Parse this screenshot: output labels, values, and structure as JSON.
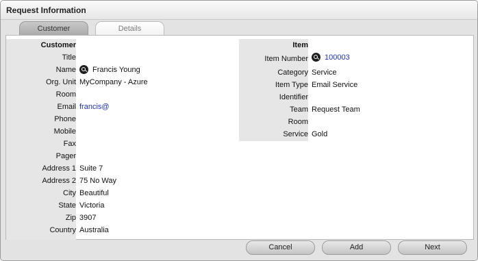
{
  "window": {
    "title": "Request Information"
  },
  "tabs": [
    {
      "label": "Customer",
      "active": true
    },
    {
      "label": "Details",
      "active": false
    }
  ],
  "customer": {
    "header": "Customer",
    "fields": [
      {
        "label": "Title",
        "value": ""
      },
      {
        "label": "Name",
        "value": "Francis Young"
      },
      {
        "label": "Org. Unit",
        "value": "MyCompany - Azure"
      },
      {
        "label": "Room",
        "value": ""
      },
      {
        "label": "Email",
        "value": "francis@"
      },
      {
        "label": "Phone",
        "value": ""
      },
      {
        "label": "Mobile",
        "value": ""
      },
      {
        "label": "Fax",
        "value": ""
      },
      {
        "label": "Pager",
        "value": ""
      },
      {
        "label": "Address 1",
        "value": "Suite 7"
      },
      {
        "label": "Address 2",
        "value": "75 No Way"
      },
      {
        "label": "City",
        "value": "Beautiful"
      },
      {
        "label": "State",
        "value": "Victoria"
      },
      {
        "label": "Zip",
        "value": "3907"
      },
      {
        "label": "Country",
        "value": "Australia"
      }
    ]
  },
  "item": {
    "header": "Item",
    "fields": [
      {
        "label": "Item Number",
        "value": "100003"
      },
      {
        "label": "Category",
        "value": "Service"
      },
      {
        "label": "Item Type",
        "value": "Email Service"
      },
      {
        "label": "Identifier",
        "value": ""
      },
      {
        "label": "Team",
        "value": "Request Team"
      },
      {
        "label": "Room",
        "value": ""
      },
      {
        "label": "Service",
        "value": "Gold"
      }
    ]
  },
  "buttons": {
    "cancel": "Cancel",
    "add": "Add",
    "next": "Next"
  },
  "colors": {
    "label_bg": "#e6e6e6",
    "link": "#1a2fcf",
    "window_bg": "#e3e3e3"
  },
  "icons": {
    "lookup": "magnifier-icon"
  }
}
